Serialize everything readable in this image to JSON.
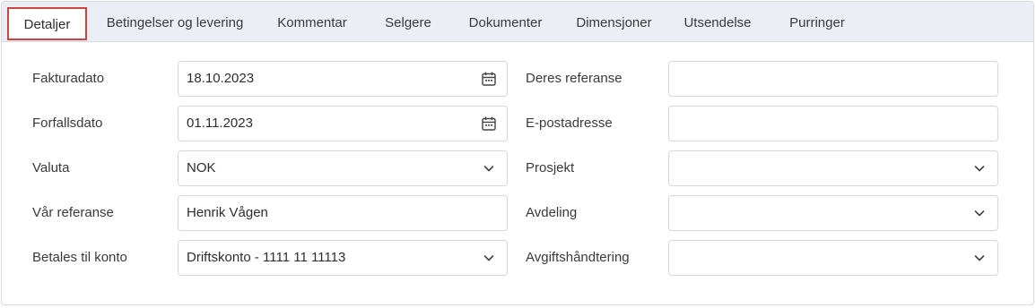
{
  "tabs": [
    {
      "label": "Detaljer",
      "active": true
    },
    {
      "label": "Betingelser og levering",
      "active": false
    },
    {
      "label": "Kommentar",
      "active": false
    },
    {
      "label": "Selgere",
      "active": false
    },
    {
      "label": "Dokumenter",
      "active": false
    },
    {
      "label": "Dimensjoner",
      "active": false
    },
    {
      "label": "Utsendelse",
      "active": false
    },
    {
      "label": "Purringer",
      "active": false
    }
  ],
  "left_form": {
    "invoice_date": {
      "label": "Fakturadato",
      "value": "18.10.2023",
      "icon": "calendar-icon"
    },
    "due_date": {
      "label": "Forfallsdato",
      "value": "01.11.2023",
      "icon": "calendar-icon"
    },
    "currency": {
      "label": "Valuta",
      "value": "NOK",
      "icon": "chevron-down-icon"
    },
    "our_reference": {
      "label": "Vår referanse",
      "value": "Henrik Vågen"
    },
    "pay_to_account": {
      "label": "Betales til konto",
      "value": "Driftskonto - 1111 11 11113",
      "icon": "chevron-down-icon"
    }
  },
  "right_form": {
    "your_reference": {
      "label": "Deres referanse",
      "value": ""
    },
    "email": {
      "label": "E-postadresse",
      "value": ""
    },
    "project": {
      "label": "Prosjekt",
      "value": "",
      "icon": "chevron-down-icon"
    },
    "department": {
      "label": "Avdeling",
      "value": "",
      "icon": "chevron-down-icon"
    },
    "fee_handling": {
      "label": "Avgiftshåndtering",
      "value": "",
      "icon": "chevron-down-icon"
    }
  },
  "colors": {
    "active_tab_border": "#d0423d",
    "tabbar_background": "#eceef6",
    "field_border": "#d5d7dc"
  }
}
